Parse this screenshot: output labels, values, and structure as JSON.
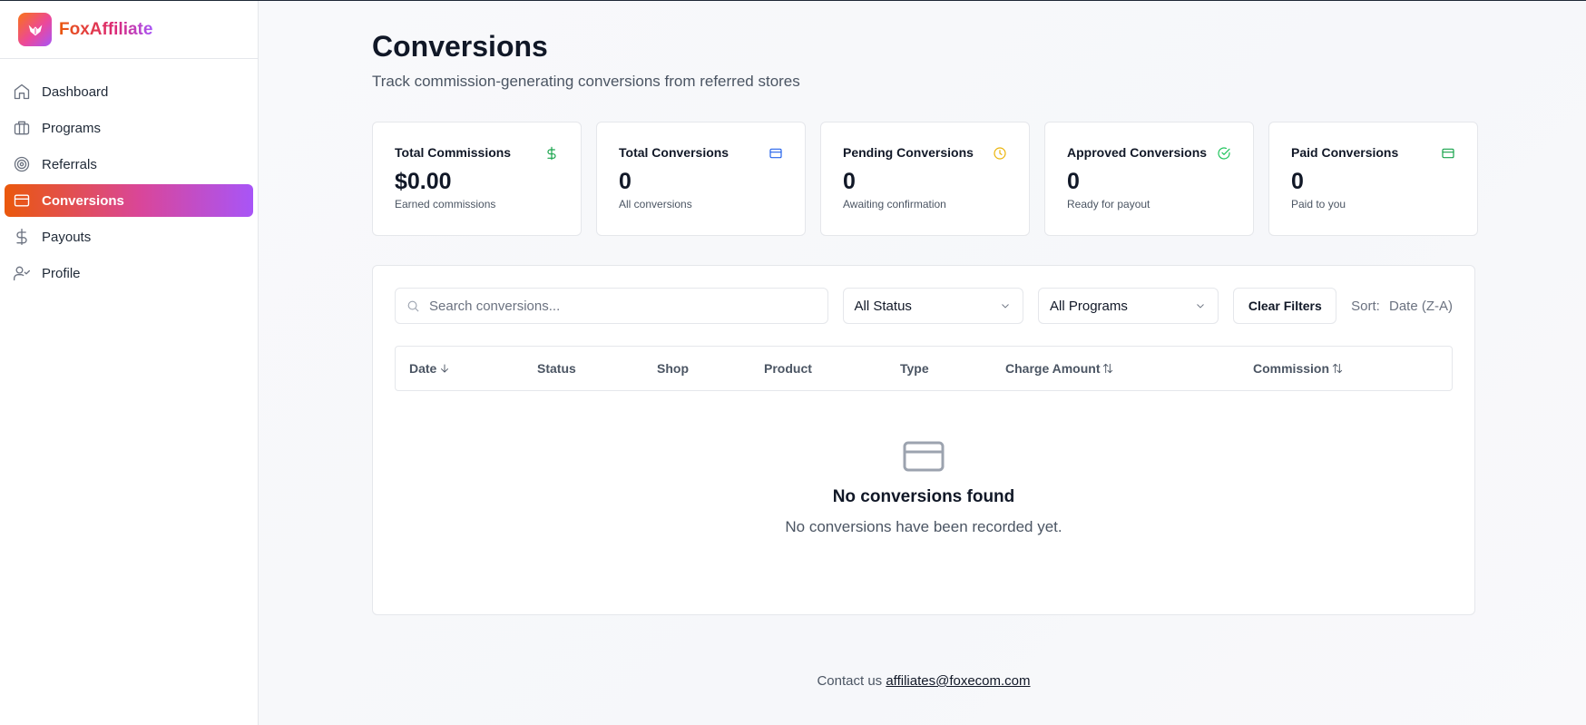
{
  "brand": {
    "name": "FoxAffiliate",
    "logo_icon": "fox-logo-icon"
  },
  "sidebar": {
    "items": [
      {
        "label": "Dashboard",
        "icon": "home-icon",
        "active": false
      },
      {
        "label": "Programs",
        "icon": "briefcase-icon",
        "active": false
      },
      {
        "label": "Referrals",
        "icon": "target-icon",
        "active": false
      },
      {
        "label": "Conversions",
        "icon": "credit-card-icon",
        "active": true
      },
      {
        "label": "Payouts",
        "icon": "dollar-icon",
        "active": false
      },
      {
        "label": "Profile",
        "icon": "user-check-icon",
        "active": false
      }
    ]
  },
  "header": {
    "title": "Conversions",
    "subtitle": "Track commission-generating conversions from referred stores"
  },
  "stats": [
    {
      "title": "Total Commissions",
      "value": "$0.00",
      "desc": "Earned commissions",
      "icon": "dollar-icon",
      "color": "#16a34a"
    },
    {
      "title": "Total Conversions",
      "value": "0",
      "desc": "All conversions",
      "icon": "credit-card-icon",
      "color": "#2563eb"
    },
    {
      "title": "Pending Conversions",
      "value": "0",
      "desc": "Awaiting confirmation",
      "icon": "clock-icon",
      "color": "#eab308"
    },
    {
      "title": "Approved Conversions",
      "value": "0",
      "desc": "Ready for payout",
      "icon": "check-circle-icon",
      "color": "#22c55e"
    },
    {
      "title": "Paid Conversions",
      "value": "0",
      "desc": "Paid to you",
      "icon": "credit-card-icon",
      "color": "#16a34a"
    }
  ],
  "filters": {
    "search_placeholder": "Search conversions...",
    "status_selected": "All Status",
    "program_selected": "All Programs",
    "clear_label": "Clear Filters",
    "sort_label": "Sort:",
    "sort_value": "Date (Z-A)"
  },
  "table": {
    "columns": [
      {
        "label": "Date",
        "sort_icon": "arrow-down-icon"
      },
      {
        "label": "Status"
      },
      {
        "label": "Shop"
      },
      {
        "label": "Product"
      },
      {
        "label": "Type"
      },
      {
        "label": "Charge Amount",
        "sort_icon": "sort-arrows-icon"
      },
      {
        "label": "Commission",
        "sort_icon": "sort-arrows-icon"
      }
    ]
  },
  "empty_state": {
    "icon": "credit-card-icon",
    "title": "No conversions found",
    "description": "No conversions have been recorded yet."
  },
  "footer": {
    "text": "Contact us",
    "email": "affiliates@foxecom.com"
  },
  "colors": {
    "accent_gradient_start": "#ea580c",
    "accent_gradient_end": "#a855f7"
  }
}
